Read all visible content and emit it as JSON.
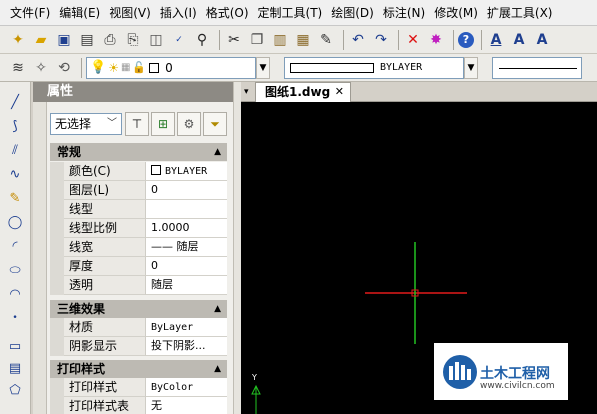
{
  "menu": [
    "文件(F)",
    "编辑(E)",
    "视图(V)",
    "插入(I)",
    "格式(O)",
    "定制工具(T)",
    "绘图(D)",
    "标注(N)",
    "修改(M)",
    "扩展工具(X)"
  ],
  "toolbar_layers": {
    "current_layer": "0",
    "color_value": "BYLAYER"
  },
  "properties": {
    "title": "属性",
    "selection": "无选择",
    "sections": [
      {
        "title": "常规",
        "rows": [
          {
            "key": "颜色(C)",
            "value": "BYLAYER"
          },
          {
            "key": "图层(L)",
            "value": "0"
          },
          {
            "key": "线型",
            "value": ""
          },
          {
            "key": "线型比例",
            "value": "1.0000"
          },
          {
            "key": "线宽",
            "value": "—— 随层"
          },
          {
            "key": "厚度",
            "value": "0"
          },
          {
            "key": "透明",
            "value": "随层"
          }
        ]
      },
      {
        "title": "三维效果",
        "rows": [
          {
            "key": "材质",
            "value": "ByLayer"
          },
          {
            "key": "阴影显示",
            "value": "投下阴影..."
          }
        ]
      },
      {
        "title": "打印样式",
        "rows": [
          {
            "key": "打印样式",
            "value": "ByColor"
          },
          {
            "key": "打印样式表",
            "value": "无"
          }
        ]
      }
    ]
  },
  "document_tab": {
    "label": "图纸1.dwg",
    "close": "✕"
  },
  "canvas": {
    "ucs_label": "Y",
    "background": "#000000",
    "crosshair_x_color": "#e21b1b",
    "crosshair_y_color": "#22c322"
  },
  "watermark": {
    "brand": "土木工程网",
    "url": "www.civilcn.com"
  },
  "icons": {
    "standard": [
      "new-icon",
      "open-icon",
      "save-icon",
      "print-preview-icon",
      "print-icon",
      "plot-icon",
      "publish-icon",
      "spell-check-icon",
      "find-icon",
      "cut-icon",
      "copy-icon",
      "paste-icon",
      "paste-special-icon",
      "match-prop-icon",
      "undo-icon",
      "redo-icon",
      "erase-icon",
      "explode-icon",
      "help-icon"
    ],
    "draw": [
      "line-icon",
      "polyline-icon",
      "multiline-icon",
      "spline-icon",
      "revision-cloud-icon",
      "circle-icon",
      "arc-icon",
      "ellipse-icon",
      "ellipse-arc-icon",
      "point-icon",
      "rectangle-icon",
      "hatch-icon",
      "polygon-icon"
    ]
  }
}
